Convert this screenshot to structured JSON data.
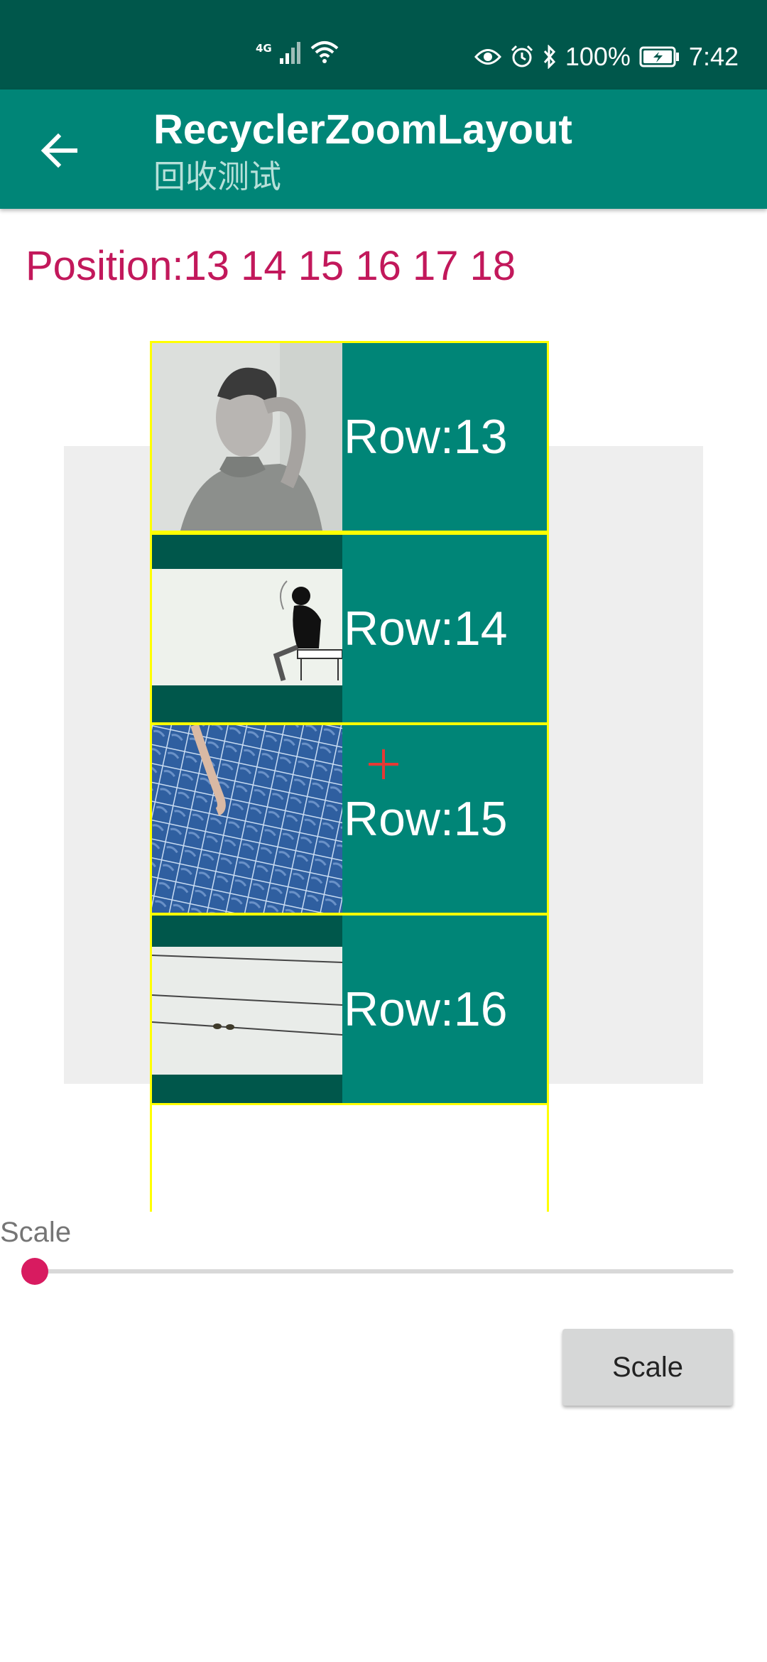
{
  "status_bar": {
    "network": "4G",
    "battery": "100%",
    "time": "7:42"
  },
  "app_bar": {
    "title": "RecyclerZoomLayout",
    "subtitle": "回收测试"
  },
  "position_text": "Position:13 14 15 16 17 18",
  "rows": [
    {
      "label": "Row:13",
      "image": "boy-portrait-image"
    },
    {
      "label": "Row:14",
      "image": "sketch-boy-image"
    },
    {
      "label": "Row:15",
      "image": "pool-tiles-image"
    },
    {
      "label": "Row:16",
      "image": "birds-on-wire-image"
    }
  ],
  "scale": {
    "label": "Scale",
    "slider_fraction": 0.0,
    "button_label": "Scale"
  },
  "colors": {
    "status_bar": "#00574b",
    "app_bar": "#008577",
    "accent": "#d81b60",
    "position_text": "#c2185b",
    "row_border": "#ffff00",
    "crosshair": "#e53935"
  }
}
